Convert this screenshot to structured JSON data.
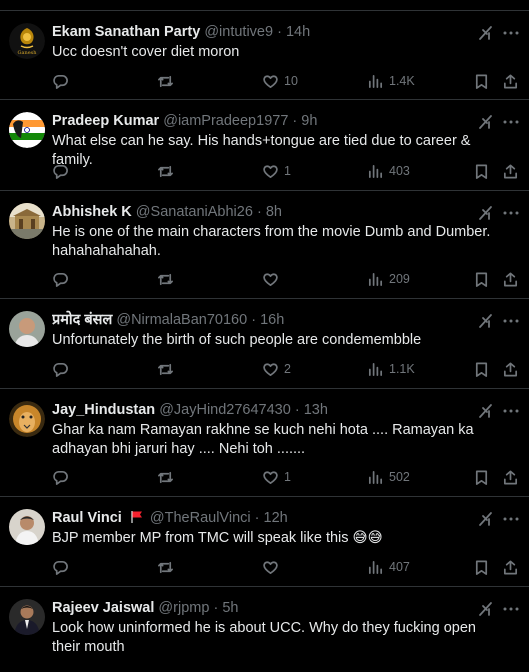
{
  "tweets": [
    {
      "name": "Ekam Sanathan Party",
      "handle": "@intutive9",
      "time": "14h",
      "text": "Ucc doesn't cover diet moron",
      "replies": "",
      "retweets": "",
      "likes": "10",
      "views": "1.4K",
      "avatar": "gold-emblem-logo",
      "avatar_caption": "Ganesh"
    },
    {
      "name": "Pradeep Kumar",
      "handle": "@iamPradeep1977",
      "time": "9h",
      "text": "What else can he say. His hands+tongue are tied due to career & family.",
      "replies": "",
      "retweets": "",
      "likes": "1",
      "views": "403",
      "avatar": "tricolor-flag"
    },
    {
      "name": "Abhishek K",
      "handle": "@SanataniAbhi26",
      "time": "8h",
      "text": "He is one of the main characters from the movie Dumb and Dumber. hahahahahahah.",
      "replies": "",
      "retweets": "",
      "likes": "",
      "views": "209",
      "avatar": "temple-photo"
    },
    {
      "name": "प्रमोद बंसल",
      "handle": "@NirmalaBan70160",
      "time": "16h",
      "text": "Unfortunately the birth of such people are condemembble",
      "replies": "",
      "retweets": "",
      "likes": "2",
      "views": "1.1K",
      "avatar": "man-photo"
    },
    {
      "name": "Jay_Hindustan",
      "handle": "@JayHind27647430",
      "time": "13h",
      "text": "Ghar ka nam Ramayan rakhne se kuch nehi hota .... Ramayan ka adhayan bhi jaruri hay .... Nehi toh .......",
      "replies": "",
      "retweets": "",
      "likes": "1",
      "views": "502",
      "avatar": "lion-face"
    },
    {
      "name": "Raul Vinci",
      "handle": "@TheRaulVinci",
      "time": "12h",
      "text": "BJP member MP from TMC will speak like this 😅😅",
      "replies": "",
      "retweets": "",
      "likes": "",
      "views": "407",
      "avatar": "man-photo",
      "has_flag": true
    },
    {
      "name": "Rajeev Jaiswal",
      "handle": "@rjpmp",
      "time": "5h",
      "text": "Look how uninformed he is about UCC. Why do they fucking open their mouth",
      "replies": "",
      "retweets": "",
      "likes": "",
      "views": "",
      "avatar": "man-suit-photo"
    }
  ],
  "icons": {
    "reply": "reply-icon",
    "retweet": "retweet-icon",
    "like": "like-icon",
    "views": "views-icon",
    "bookmark": "bookmark-icon",
    "share": "share-icon",
    "grok": "grok-icon",
    "more": "more-icon"
  },
  "colors": {
    "background": "#000000",
    "text": "#e7e9ea",
    "muted": "#71767b",
    "divider": "#2f3336",
    "flag": "#f4212e"
  }
}
